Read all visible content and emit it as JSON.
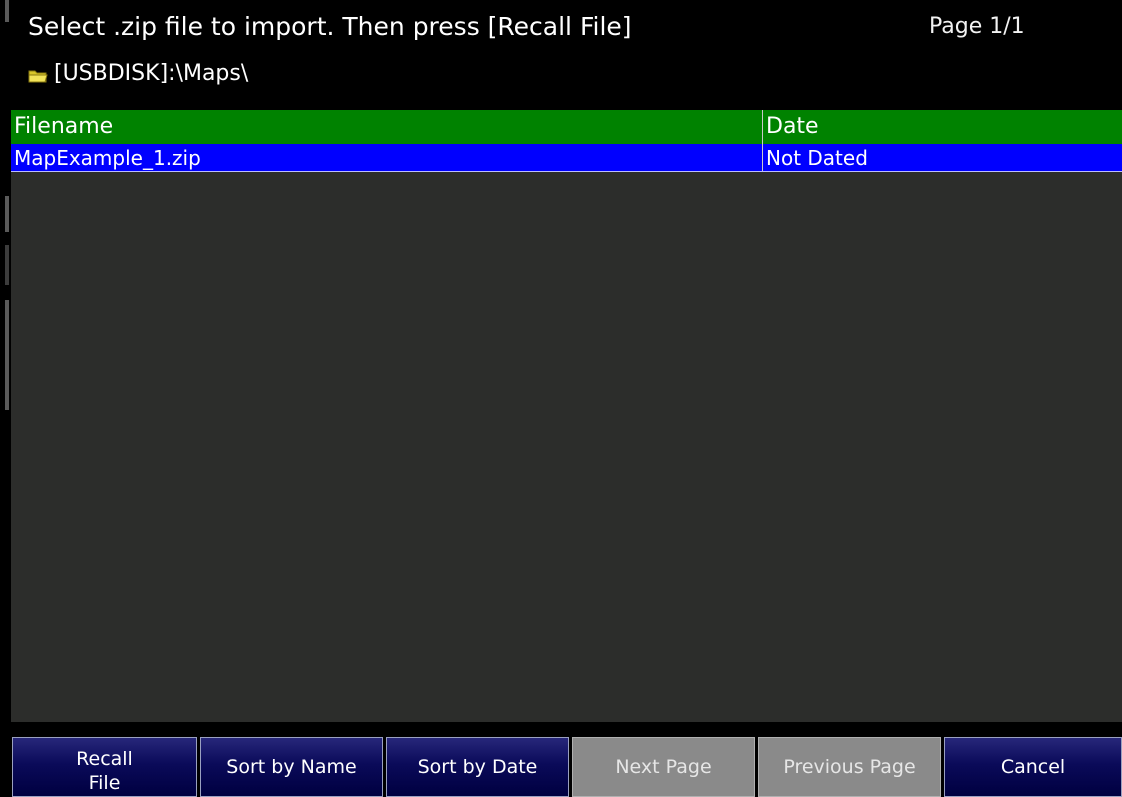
{
  "header": {
    "title": "Select .zip file to import.  Then press [Recall File]",
    "page": "Page 1/1",
    "path": "[USBDISK]:\\Maps\\",
    "folder_icon": "folder-icon"
  },
  "table": {
    "columns": [
      "Filename",
      "Date"
    ],
    "rows": [
      {
        "filename": "MapExample_1.zip",
        "date": "Not Dated"
      }
    ]
  },
  "softkeys": [
    {
      "label": "Recall\nFile",
      "enabled": true
    },
    {
      "label": "Sort by Name",
      "enabled": true
    },
    {
      "label": "Sort by Date",
      "enabled": true
    },
    {
      "label": "Next Page",
      "enabled": false
    },
    {
      "label": "Previous Page",
      "enabled": false
    },
    {
      "label": "Cancel",
      "enabled": true
    }
  ],
  "colors": {
    "header_bar": "#008200",
    "selected_row": "#0000ff",
    "list_background": "#2c2d2b",
    "softkey": "#0a0a59",
    "softkey_disabled": "#8a8a8a"
  }
}
